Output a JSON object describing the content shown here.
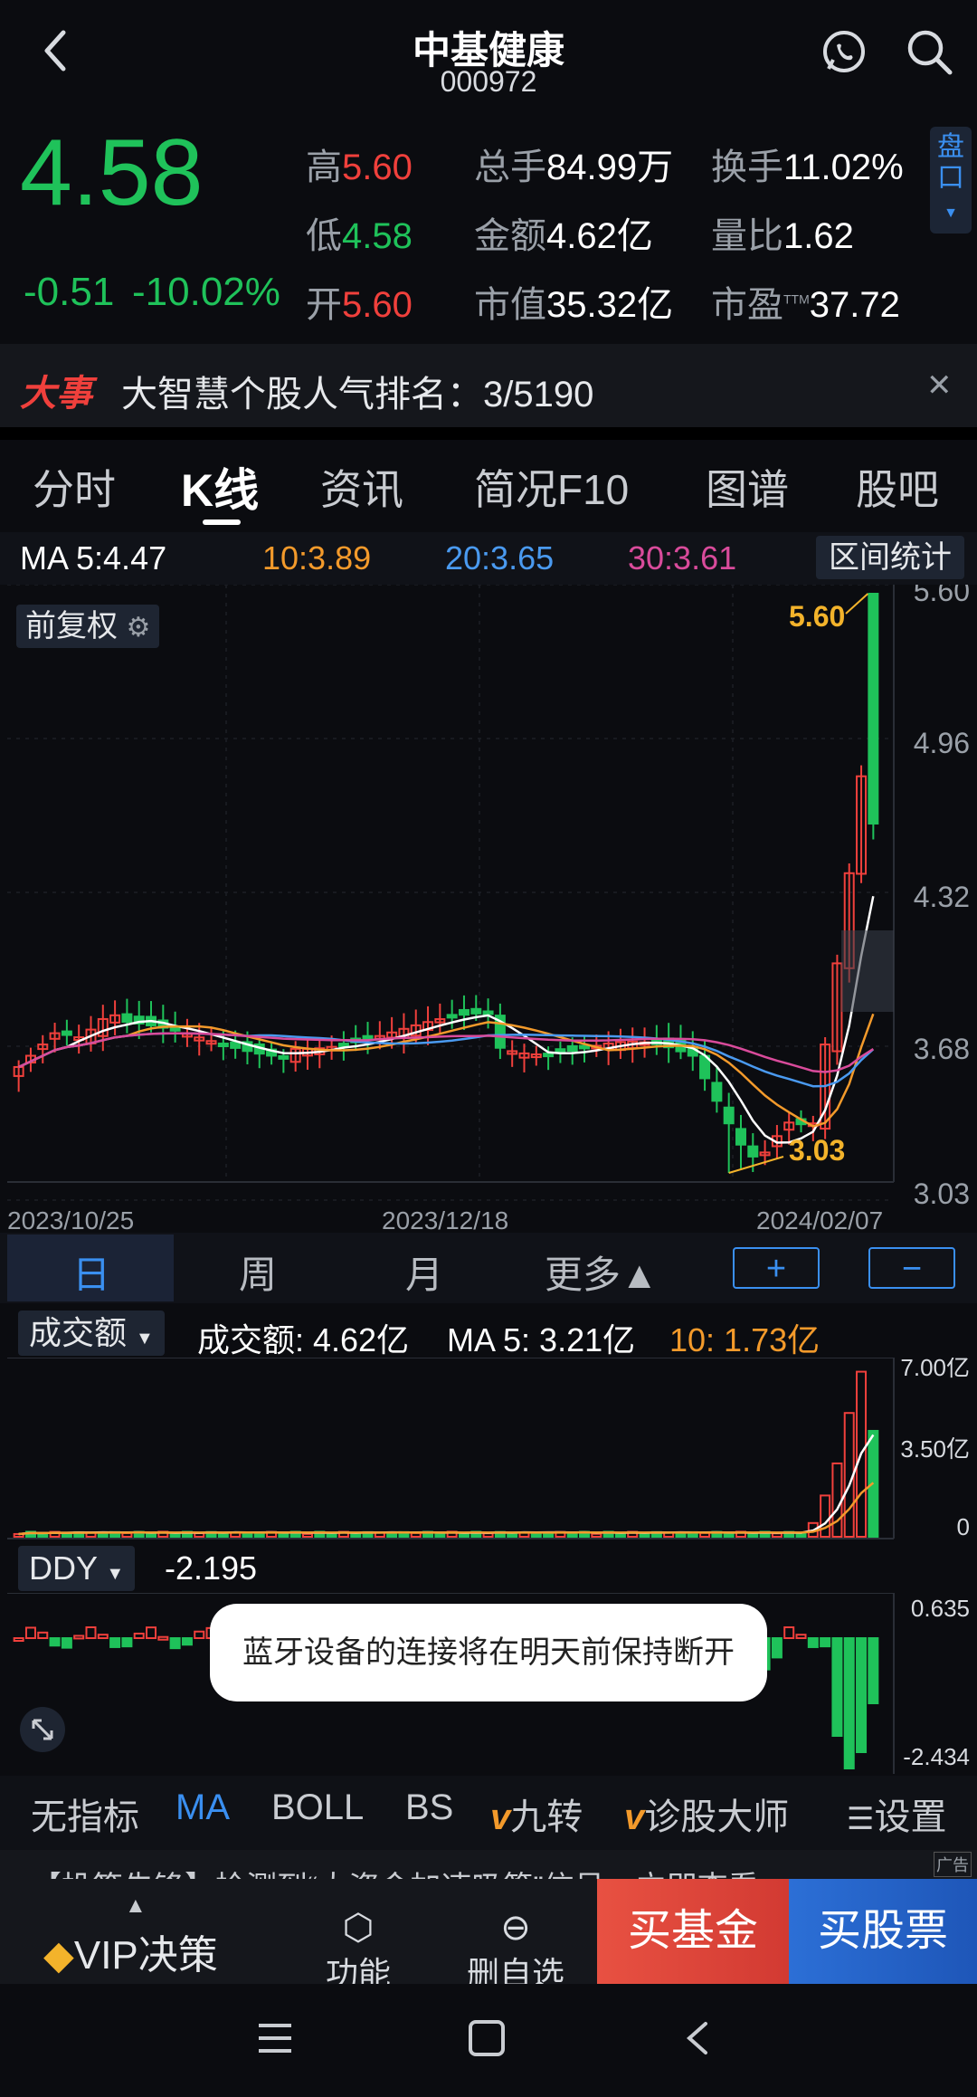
{
  "header": {
    "title": "中基健康",
    "code": "000972"
  },
  "quote": {
    "price": "4.58",
    "change": "-0.51",
    "change_pct": "-10.02%",
    "stats": [
      {
        "label": "高",
        "value": "5.60"
      },
      {
        "label": "低",
        "value": "4.58"
      },
      {
        "label": "开",
        "value": "5.60"
      },
      {
        "label": "总手",
        "value": "84.99万"
      },
      {
        "label": "金额",
        "value": "4.62亿"
      },
      {
        "label": "市值",
        "value": "35.32亿"
      },
      {
        "label": "换手",
        "value": "11.02%"
      },
      {
        "label": "量比",
        "value": "1.62"
      },
      {
        "label": "市盈",
        "value": "37.72",
        "sup": "TTM"
      }
    ],
    "pankou": "盘口"
  },
  "news": {
    "badge": "大事",
    "text": "大智慧个股人气排名：3/5190"
  },
  "tabs": [
    "分时",
    "K线",
    "资讯",
    "简况F10",
    "图谱",
    "股吧"
  ],
  "ma_bar": {
    "ma5": "MA 5:4.47",
    "ma10": "10:3.89",
    "ma20": "20:3.65",
    "ma30": "30:3.61",
    "range_btn": "区间统计"
  },
  "kchart": {
    "adj_label": "前复权",
    "y_ticks": [
      "5.60",
      "4.96",
      "4.32",
      "3.68",
      "3.03"
    ],
    "dates": [
      "2023/10/25",
      "2023/12/18",
      "2024/02/07"
    ],
    "high_label": "5.60",
    "low_label": "3.03"
  },
  "period_tabs": [
    "日",
    "周",
    "月",
    "更多▲"
  ],
  "zoom": {
    "plus": "+",
    "minus": "−"
  },
  "volume": {
    "selector": "成交额",
    "value": "成交额: 4.62亿",
    "ma5": "MA 5: 3.21亿",
    "ma10": "10: 1.73亿",
    "y_ticks": [
      "7.00亿",
      "3.50亿",
      "0"
    ]
  },
  "ddy": {
    "selector": "DDY",
    "value": "-2.195",
    "y_ticks": [
      "0.635",
      "-2.434"
    ]
  },
  "toast": "蓝牙设备的连接将在明天前保持断开",
  "indicators": [
    "无指标",
    "MA",
    "BOLL",
    "BS",
    "九转",
    "诊股大师",
    "设置"
  ],
  "ad": {
    "text": "【投策先锋】检测到“大资金加速吸筹”信号，立即查看",
    "tag": "广告"
  },
  "bottom_nav": {
    "vip": "VIP决策",
    "func": "功能",
    "delete": "删自选",
    "buy_fund": "买基金",
    "open_account": "买股票"
  },
  "colors": {
    "up": "#f0403c",
    "down": "#1fc25a",
    "ma5": "#ffffff",
    "ma10": "#f39a2b",
    "ma20": "#4a9af0",
    "ma30": "#d94b9b",
    "accent_blue": "#3a8ff0"
  }
}
